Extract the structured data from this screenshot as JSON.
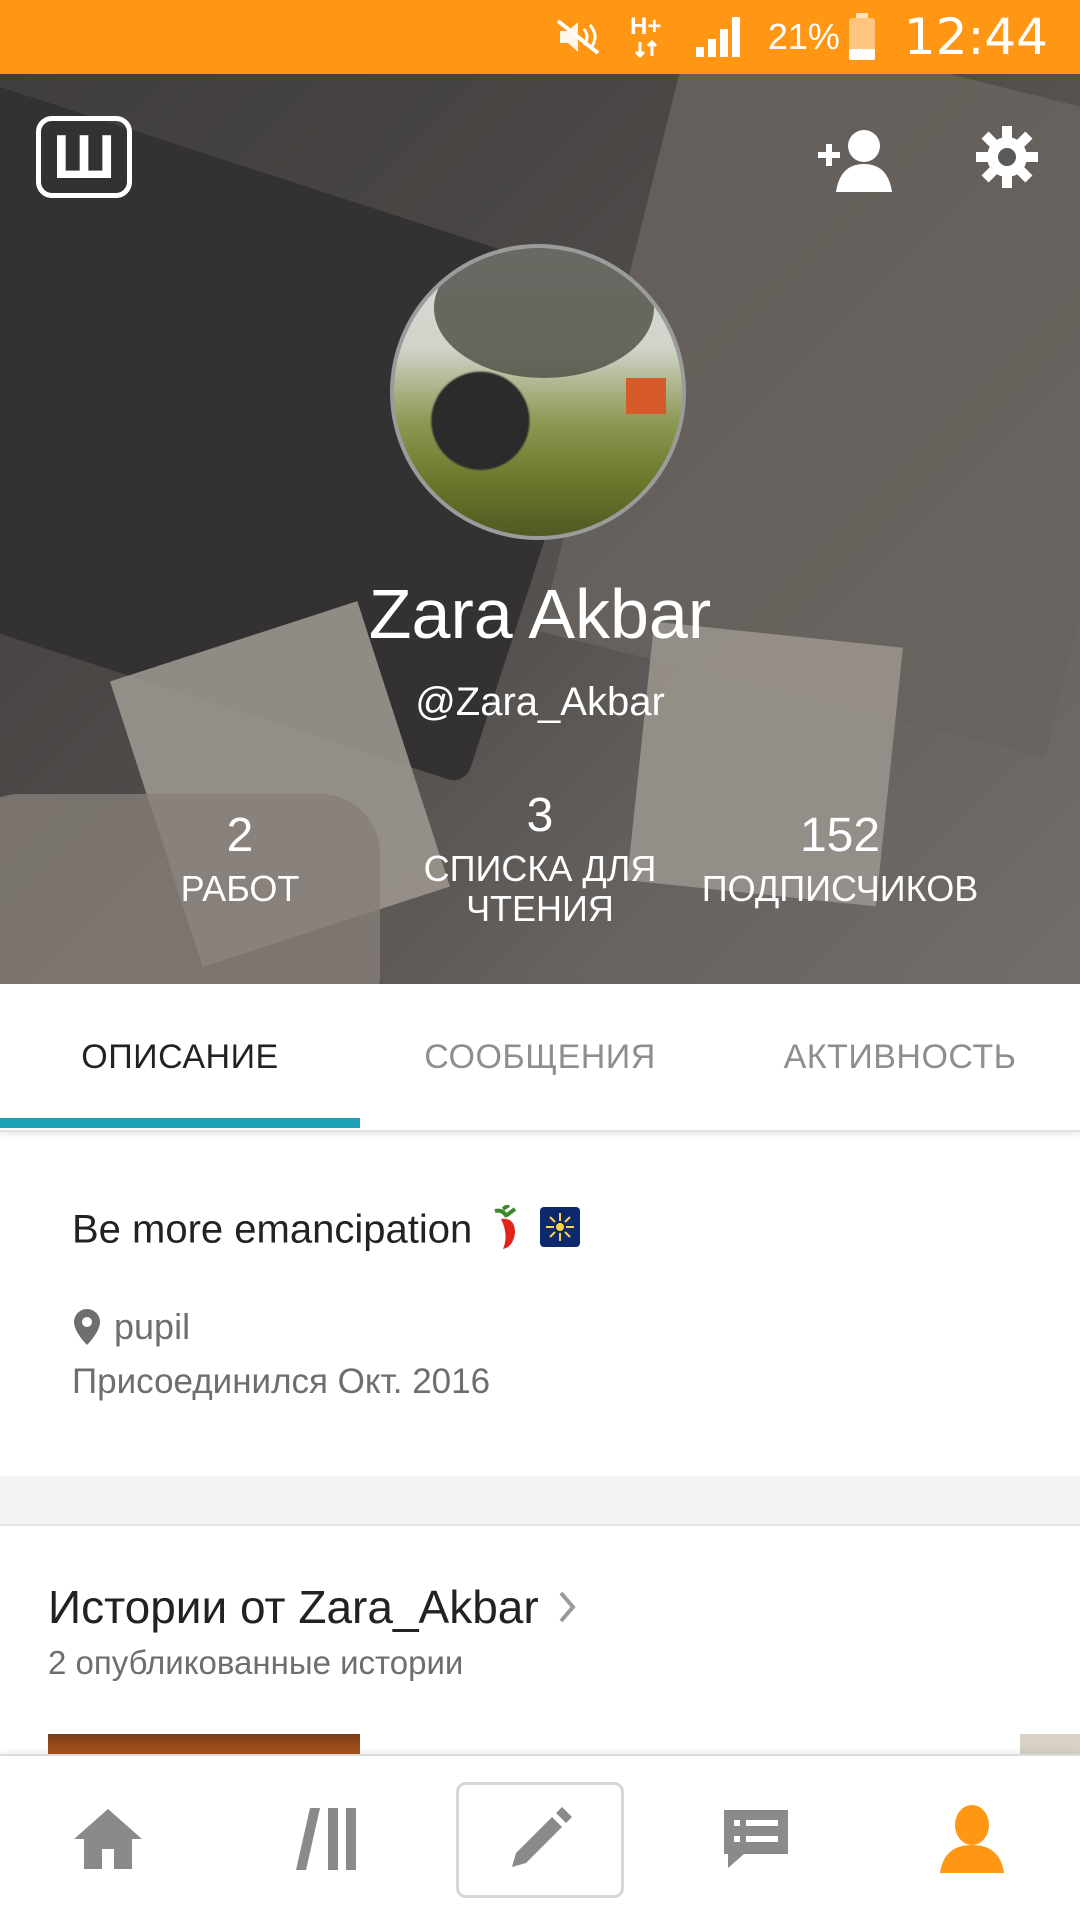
{
  "status_bar": {
    "battery_percent": "21%",
    "time": "12:44",
    "network_type": "H+",
    "icons": [
      "mute-icon",
      "network-h-plus-icon",
      "signal-icon",
      "battery-icon"
    ],
    "background_color": "#ff9614"
  },
  "header": {
    "app_logo": "Ш",
    "actions": [
      {
        "name": "follow-user-icon"
      },
      {
        "name": "settings-gear-icon"
      }
    ]
  },
  "profile": {
    "name": "Zara Akbar",
    "username": "@Zara_Akbar"
  },
  "stats": [
    {
      "value": "2",
      "label": "РАБОТ"
    },
    {
      "value": "3",
      "label_line1": "СПИСКА ДЛЯ",
      "label_line2": "ЧТЕНИЯ"
    },
    {
      "value": "152",
      "label": "ПОДПИСЧИКОВ"
    }
  ],
  "tabs": [
    {
      "label": "ОПИСАНИЕ",
      "active": true
    },
    {
      "label": "СООБЩЕНИЯ",
      "active": false
    },
    {
      "label": "АКТИВНОСТЬ",
      "active": false
    }
  ],
  "about": {
    "bio": "Be more emancipation",
    "location": "pupil",
    "joined": "Присоединился Окт. 2016"
  },
  "stories": {
    "title": "Истории от Zara_Akbar",
    "subtitle": "2 опубликованные истории"
  },
  "bottom_nav": [
    {
      "name": "home-icon",
      "active": false
    },
    {
      "name": "library-icon",
      "active": false
    },
    {
      "name": "write-pencil-icon",
      "active": false
    },
    {
      "name": "messages-icon",
      "active": false
    },
    {
      "name": "profile-icon",
      "active": true
    }
  ],
  "colors": {
    "accent_orange": "#ff9614",
    "tab_indicator": "#1da1b5",
    "nav_icon": "#8a8a8a"
  }
}
